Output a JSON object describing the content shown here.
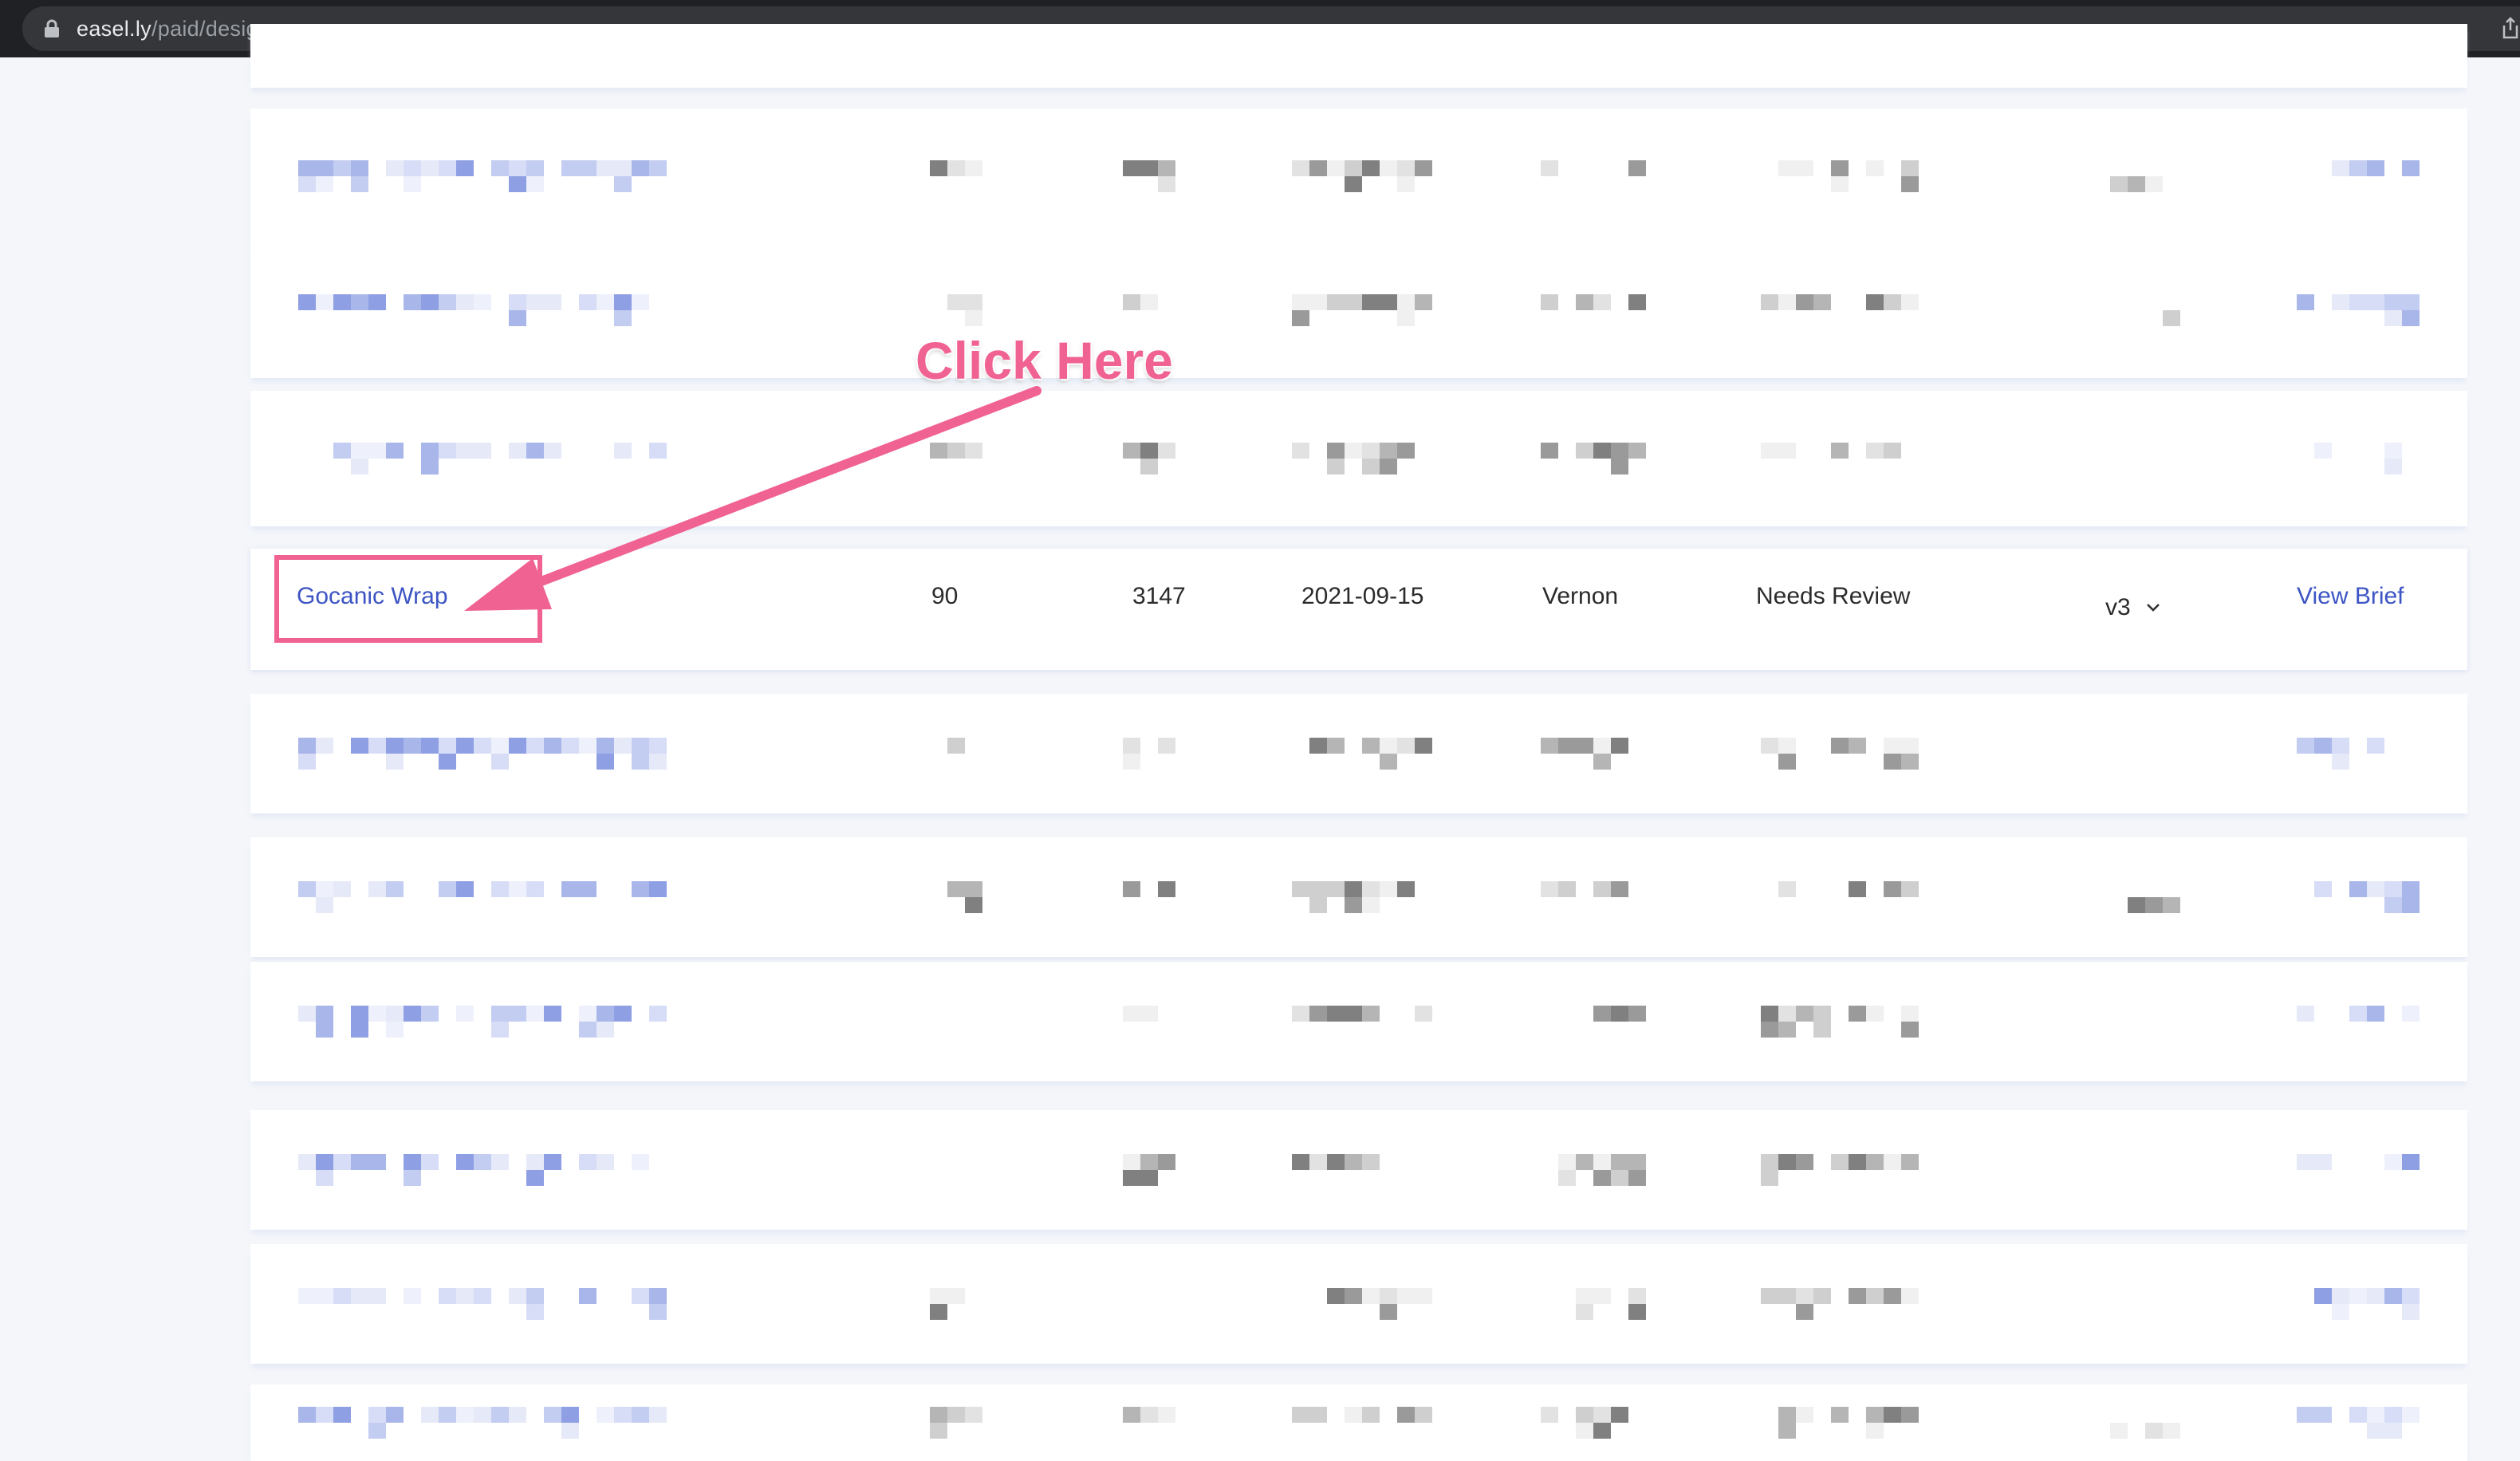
{
  "browser": {
    "url_domain": "easel.ly",
    "url_path": "/paid/designs"
  },
  "active_row": {
    "design_name": "Gocanic Wrap",
    "col_2": "90",
    "col_3": "3147",
    "date": "2021-09-15",
    "designer": "Vernon",
    "status": "Needs Review",
    "version": "v3",
    "action_link": "View Brief"
  },
  "annotation": {
    "label": "Click Here",
    "color": "#f06292"
  },
  "colors": {
    "link": "#3d55c4",
    "page_background": "#f4f6fa",
    "row_background": "#ffffff"
  },
  "icons": [
    "lock-icon",
    "share-icon",
    "chevron-down-icon",
    "arrow-icon"
  ]
}
